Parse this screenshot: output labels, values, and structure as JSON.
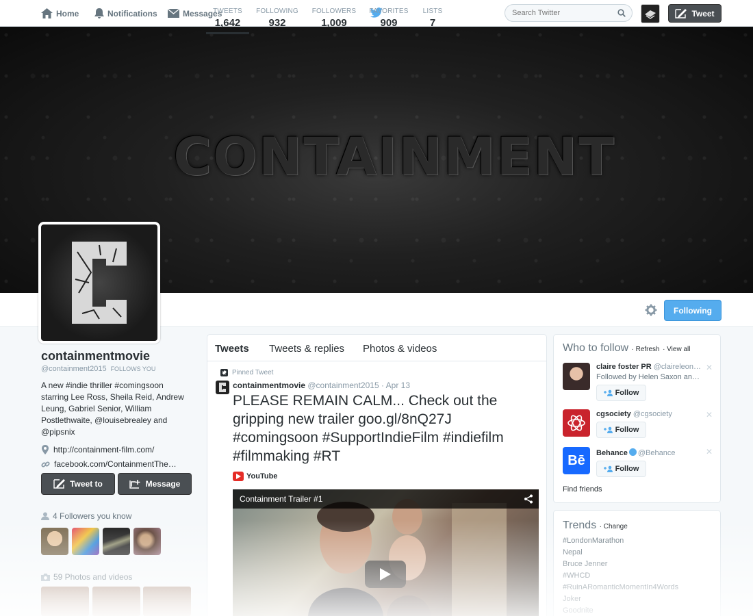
{
  "nav": {
    "home": "Home",
    "notifications": "Notifications",
    "messages": "Messages",
    "search_placeholder": "Search Twitter",
    "tweet": "Tweet"
  },
  "header": {
    "title": "CONTAINMENT"
  },
  "stats": [
    {
      "label": "TWEETS",
      "value": "1,642"
    },
    {
      "label": "FOLLOWING",
      "value": "932"
    },
    {
      "label": "FOLLOWERS",
      "value": "1,009"
    },
    {
      "label": "FAVORITES",
      "value": "909"
    },
    {
      "label": "LISTS",
      "value": "7"
    }
  ],
  "following_button": "Following",
  "profile": {
    "name": "containmentmovie",
    "screen_name": "@containment2015",
    "follows_you": "FOLLOWS YOU",
    "bio": "A new #indie thriller #comingsoon starring Lee Ross, Sheila Reid, Andrew Leung, Gabriel Senior, William Postlethwaite, @louisebrealey and @pipsnix",
    "website": "http://containment-film.com/",
    "facebook": "facebook.com/ContainmentThe…",
    "tweet_to": "Tweet to",
    "message": "Message",
    "followers_you_know": "4 Followers you know",
    "photos_videos": "59 Photos and videos"
  },
  "tabs": [
    "Tweets",
    "Tweets & replies",
    "Photos & videos"
  ],
  "tweet": {
    "pinned_label": "Pinned Tweet",
    "name": "containmentmovie",
    "screen_name": "@containment2015",
    "date": "· Apr 13",
    "text": "PLEASE REMAIN CALM... Check out the gripping new trailer  goo.gl/8nQ27J #comingsoon #SupportIndieFilm #indiefilm #filmmaking #RT",
    "source": "YouTube",
    "video_title": "Containment Trailer #1"
  },
  "who_to_follow": {
    "title": "Who to follow",
    "refresh": "· Refresh",
    "view_all": "· View all",
    "follow_label": "Follow",
    "find_friends": "Find friends",
    "suggestions": [
      {
        "name": "claire foster PR",
        "handle": "@claireleon…",
        "sub": "Followed by Helen Saxon an…"
      },
      {
        "name": "cgsociety",
        "handle": "@cgsociety",
        "sub": ""
      },
      {
        "name": "Behance",
        "handle": "@Behance",
        "sub": ""
      }
    ]
  },
  "trends": {
    "title": "Trends",
    "change": "· Change",
    "items": [
      "#LondonMarathon",
      "Nepal",
      "Bruce Jenner",
      "#WHCD",
      "#RuinARomanticMomentIn4Words",
      "Joker",
      "Goodnite"
    ]
  },
  "colors": {
    "accent": "#55acee",
    "dark_button": "#4a4f53",
    "text": "#292f33",
    "muted": "#8899a6"
  }
}
